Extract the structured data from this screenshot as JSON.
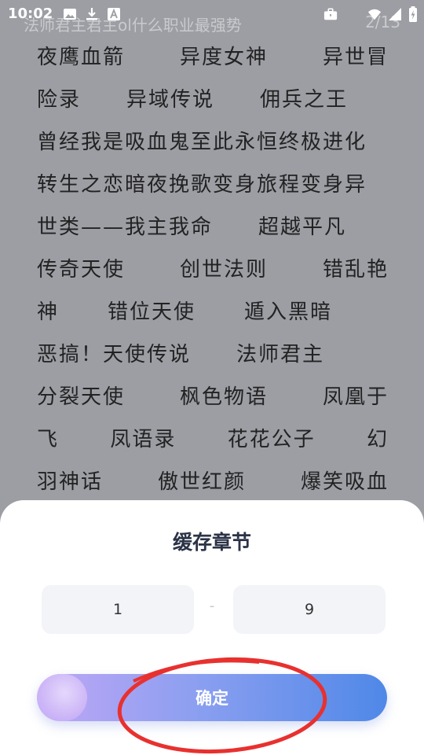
{
  "status_bar": {
    "time": "10:02",
    "left_icons": [
      "image-icon",
      "download-icon",
      "font-icon"
    ],
    "right_icons": [
      "briefcase-icon",
      "wifi-icon",
      "signal-icon",
      "battery-charging-icon"
    ]
  },
  "reader": {
    "title": "法师君主君主ol什么职业最强势",
    "page": "2/13",
    "lines": [
      [
        "夜鹰血箭",
        "异度女神",
        "异世冒"
      ],
      [
        "险录",
        "异域传说",
        "佣兵之王"
      ],
      [
        "曾经我是吸血鬼至此永恒终极进化"
      ],
      [
        "转生之恋暗夜挽歌变身旅程变身异"
      ],
      [
        "世类——我主我命",
        "超越平凡"
      ],
      [
        "传奇天使",
        "创世法则",
        "错乱艳"
      ],
      [
        "神",
        "错位天使",
        "遁入黑暗"
      ],
      [
        "恶搞！天使传说",
        "法师君主"
      ],
      [
        "分裂天使",
        "枫色物语",
        "凤凰于"
      ],
      [
        "飞",
        "凤语录",
        "花花公子",
        "幻"
      ],
      [
        "羽神话",
        "傲世红颜",
        "爆笑吸血"
      ]
    ]
  },
  "cache_sheet": {
    "title": "缓存章节",
    "from_value": "1",
    "separator": "-",
    "to_value": "9",
    "confirm_label": "确定"
  },
  "colors": {
    "overlay_background": "#9c9ea4",
    "button_gradient_start": "#c0a6f6",
    "button_gradient_end": "#4f88e8",
    "annotation_circle": "#e8312f"
  }
}
